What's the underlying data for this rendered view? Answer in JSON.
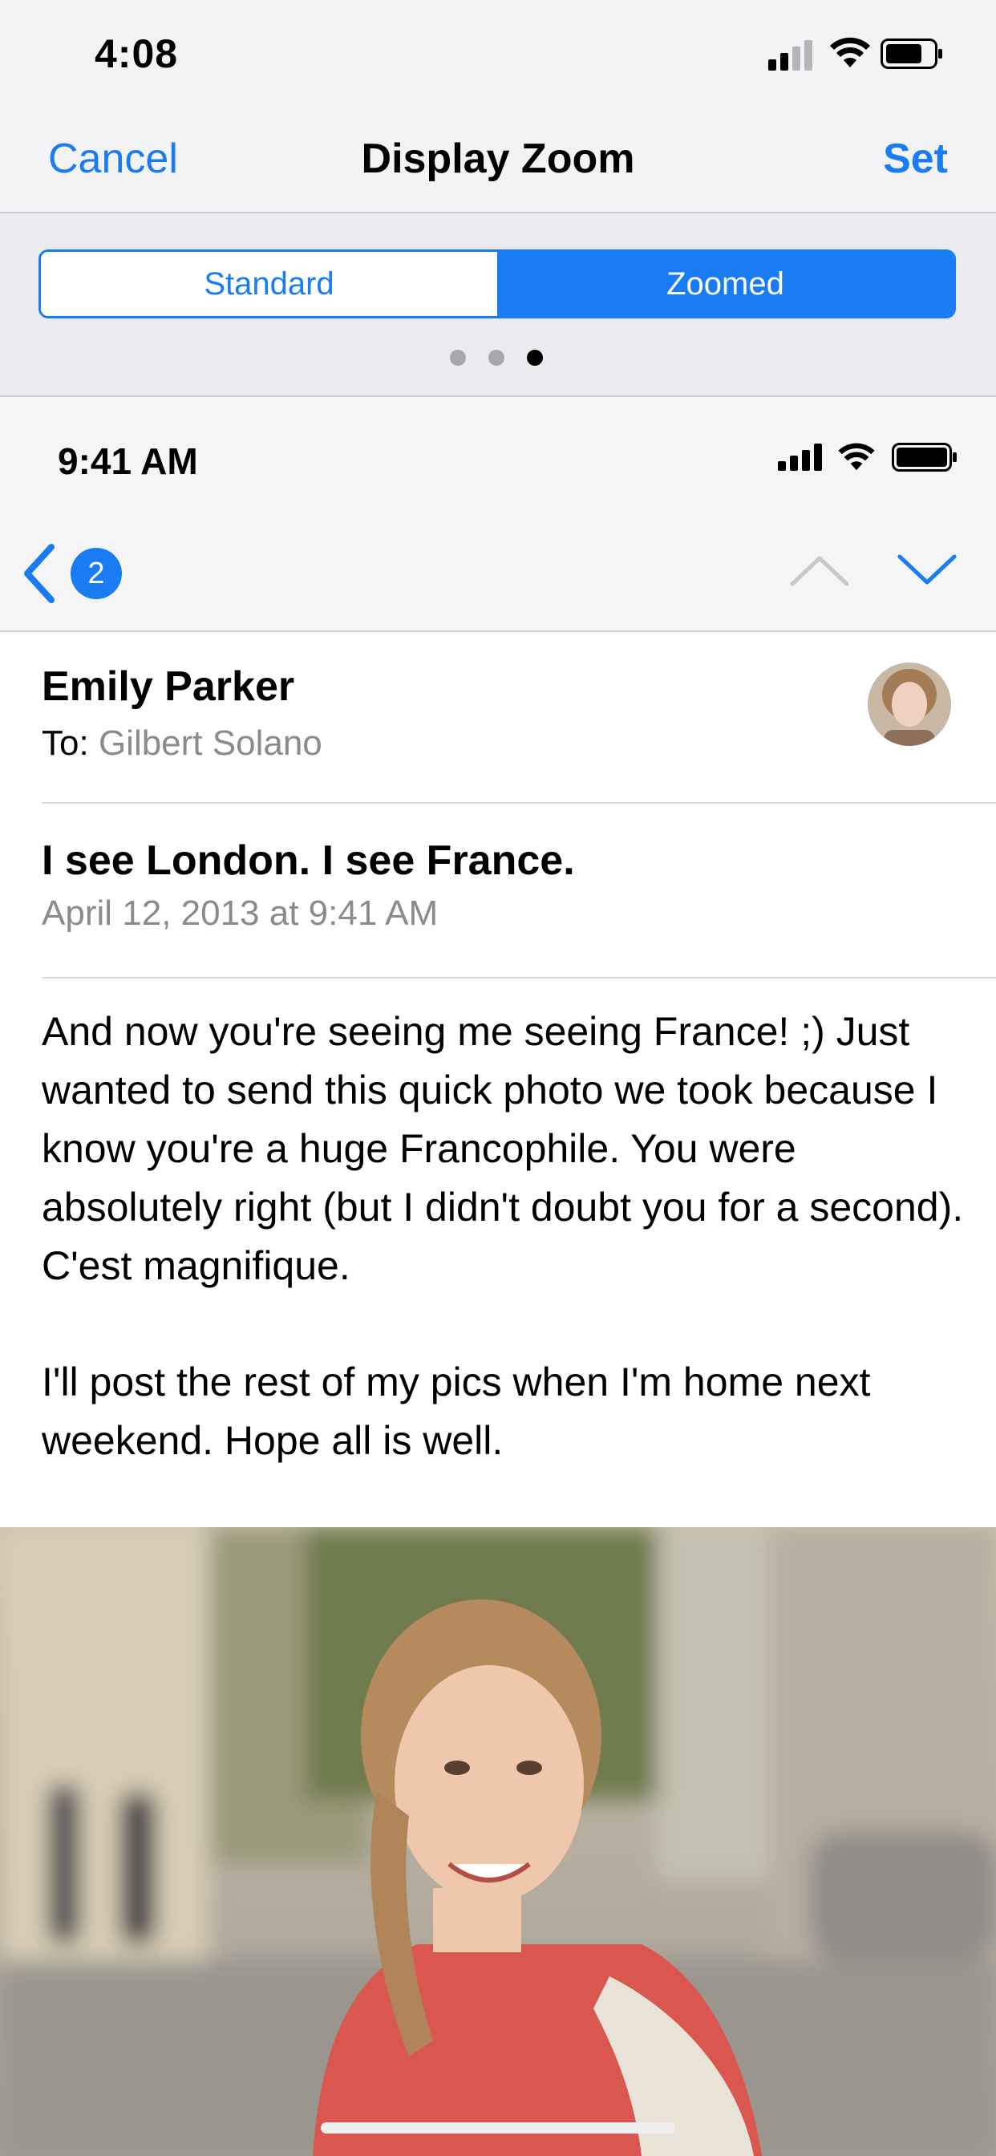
{
  "status_bar": {
    "time": "4:08"
  },
  "nav": {
    "cancel_label": "Cancel",
    "title": "Display Zoom",
    "set_label": "Set"
  },
  "segmented": {
    "standard_label": "Standard",
    "zoomed_label": "Zoomed",
    "selected": "Zoomed"
  },
  "page_indicator": {
    "total": 3,
    "current": 3
  },
  "preview": {
    "status_time": "9:41 AM",
    "message_count": "2",
    "email": {
      "sender": "Emily Parker",
      "to_label": "To:",
      "to_name": "Gilbert Solano",
      "subject": "I see London. I see France.",
      "date": "April 12, 2013 at 9:41 AM",
      "body_paragraph_1": "And now you're seeing me seeing France! ;) Just wanted to send this quick photo we took because I know you're a huge Francophile. You were absolutely right (but I didn't doubt you for a second). C'est magnifique.",
      "body_paragraph_2": "I'll post the rest of my pics when I'm home next weekend. Hope all is well."
    }
  },
  "colors": {
    "accent": "#1a7cf2",
    "secondary_text": "#8a8a8f",
    "bar_background": "#f3f3f6"
  }
}
